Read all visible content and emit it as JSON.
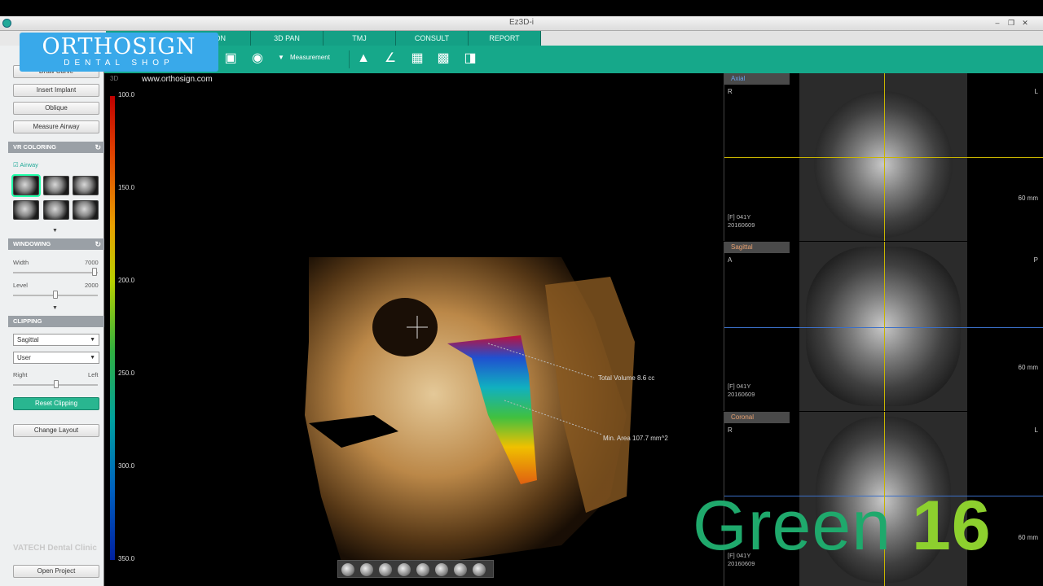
{
  "window": {
    "title": "Ez3D-i"
  },
  "tabs": [
    "3D PAN",
    "TMJ",
    "CONSULT",
    "REPORT"
  ],
  "tab_partial": "ON",
  "toolbar": {
    "measurement_label": "Measurement",
    "icons": [
      "camera-icon",
      "layers-icon",
      "dropdown-caret-icon",
      "ceph-tool-icon",
      "angle-tool-icon",
      "image-icon",
      "film-icon",
      "box-icon"
    ]
  },
  "watermark": {
    "brand": "ORTHOSIGN",
    "tagline": "DENTAL SHOP",
    "website": "www.orthosign.com",
    "overlay_text_1": "Green",
    "overlay_text_2": "16"
  },
  "left_panel": {
    "buttons": [
      "Draw Curve",
      "Insert Implant",
      "Oblique",
      "Measure Airway"
    ],
    "vr_coloring": {
      "title": "VR COLORING",
      "checkbox_label": "Airway",
      "checkbox_checked": true
    },
    "windowing": {
      "title": "WINDOWING",
      "width_label": "Width",
      "width_value": "7000",
      "level_label": "Level",
      "level_value": "2000"
    },
    "clipping": {
      "title": "CLIPPING",
      "plane_select": "Sagittal",
      "mode_select": "User",
      "right_label": "Right",
      "left_label": "Left",
      "reset_button": "Reset Clipping"
    },
    "change_layout_button": "Change Layout",
    "brand_watermark": "VATECH Dental Clinic",
    "open_project_button": "Open Project"
  },
  "viewport": {
    "tag": "3D",
    "colorbar_labels": [
      "100.0",
      "150.0",
      "200.0",
      "250.0",
      "300.0",
      "350.0"
    ],
    "annotation_volume": "Total Volume 8.6 cc",
    "annotation_area": "Min. Area 107.7 mm^2"
  },
  "right_panels": [
    {
      "name": "Axial",
      "left_side": "R",
      "right_side": "L",
      "info_line1": "[F] 041Y",
      "info_line2": "20160609",
      "scale": "60 mm"
    },
    {
      "name": "Sagittal",
      "left_side": "A",
      "right_side": "P",
      "info_line1": "[F] 041Y",
      "info_line2": "20160609",
      "scale": "60 mm"
    },
    {
      "name": "Coronal",
      "left_side": "R",
      "right_side": "L",
      "info_line1": "[F] 041Y",
      "info_line2": "20160609",
      "scale": "60 mm"
    }
  ]
}
